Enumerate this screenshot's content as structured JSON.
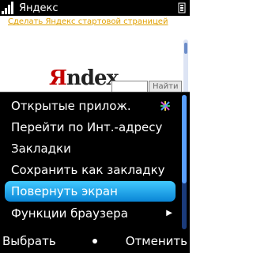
{
  "status_bar": {
    "title": "Яндекс",
    "signal_icon": "signal-strength-icon",
    "battery_icon": "battery-icon"
  },
  "webpage": {
    "homepage_link": "Сделать Яндекс стартовой страницей",
    "logo": {
      "first_letter": "Я",
      "rest": "ndex"
    },
    "search_button_label": "Найти"
  },
  "menu": {
    "items": [
      {
        "label": "Открытые прилож.",
        "icon": "open-apps-icon"
      },
      {
        "label": "Перейти по Инт.-адресу"
      },
      {
        "label": "Закладки"
      },
      {
        "label": "Сохранить как закладку"
      },
      {
        "label": "Повернуть экран",
        "selected": true
      },
      {
        "label": "Функции браузера",
        "submenu": true
      }
    ],
    "selected_color": "#1aa6ee"
  },
  "softkeys": {
    "left": "Выбрать",
    "right": "Отменить"
  }
}
